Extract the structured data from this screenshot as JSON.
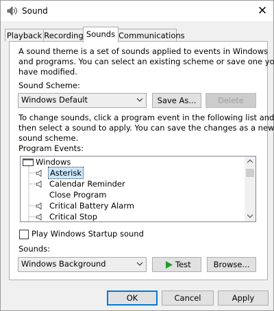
{
  "window": {
    "title": "Sound",
    "close_glyph": "✕"
  },
  "tabs": [
    {
      "label": "Playback"
    },
    {
      "label": "Recording"
    },
    {
      "label": "Sounds"
    },
    {
      "label": "Communications"
    }
  ],
  "sounds": {
    "intro_line1": "A sound theme is a set of sounds applied to events in Windows",
    "intro_line2": "and programs.  You can select an existing scheme or save one you",
    "intro_line3": "have modified.",
    "scheme_label": "Sound Scheme:",
    "scheme_value": "Windows Default",
    "save_as_label": "Save As...",
    "delete_label": "Delete",
    "change_line1": "To change sounds, click a program event in the following list and",
    "change_line2": "then select a sound to apply.  You can save the changes as a new",
    "change_line3": "sound scheme.",
    "events_label": "Program Events:",
    "events": [
      {
        "label": "Windows",
        "icon": "windows-folder-icon",
        "group": true
      },
      {
        "label": "Asterisk",
        "icon": "speaker-icon",
        "selected": true
      },
      {
        "label": "Calendar Reminder",
        "icon": "speaker-icon"
      },
      {
        "label": "Close Program",
        "icon": ""
      },
      {
        "label": "Critical Battery Alarm",
        "icon": "speaker-icon"
      },
      {
        "label": "Critical Stop",
        "icon": "speaker-icon"
      }
    ],
    "startup_label": "Play Windows Startup sound",
    "startup_checked": false,
    "sounds_label": "Sounds:",
    "sound_value": "Windows Background",
    "test_label": "Test",
    "browse_label": "Browse..."
  },
  "footer": {
    "ok_label": "OK",
    "cancel_label": "Cancel",
    "apply_label": "Apply"
  },
  "colors": {
    "accent": "#0078d7",
    "selection": "#cce8ff",
    "play_green": "#1f9a2e"
  }
}
